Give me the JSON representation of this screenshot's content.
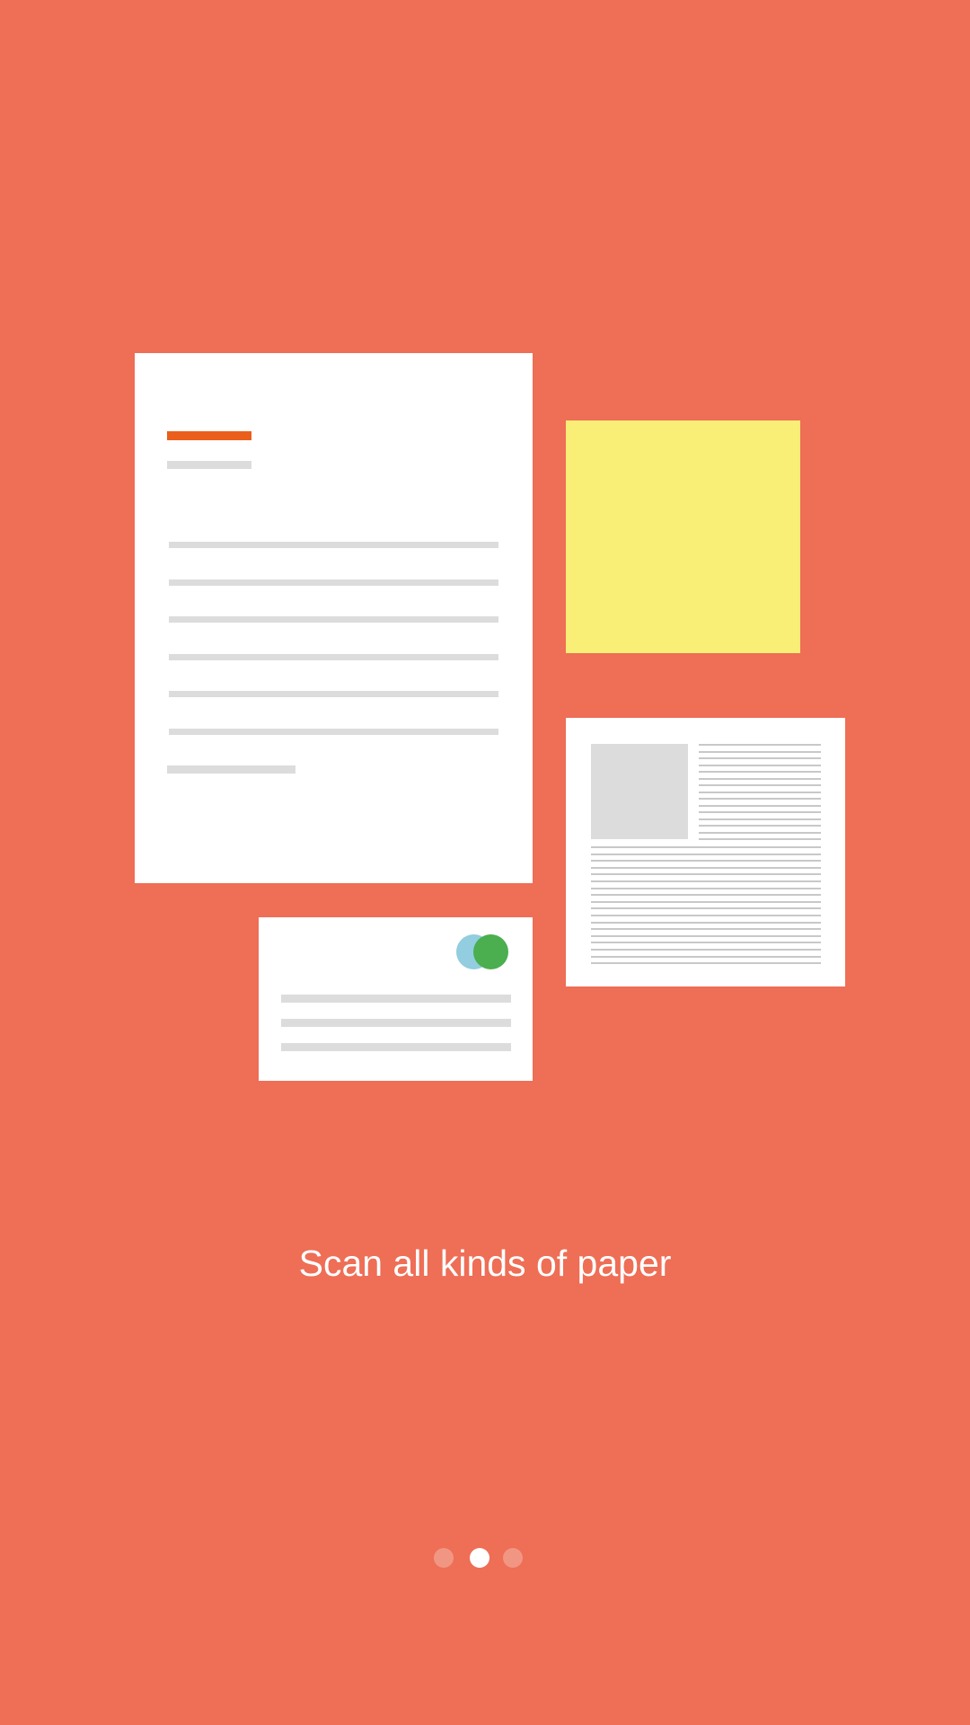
{
  "onboarding": {
    "caption": "Scan all kinds of paper",
    "page_count": 3,
    "active_page": 2
  },
  "illustration": {
    "items": [
      "letter-document",
      "sticky-note",
      "article-page",
      "business-card"
    ]
  },
  "colors": {
    "background": "#EE6E56",
    "paper": "#FFFFFF",
    "text_placeholder": "#DCDCDC",
    "letter_heading_accent": "#EA5F1B",
    "sticky_note": "#F9EE76",
    "card_logo_blue": "#92CDE0",
    "card_logo_green": "#4BAE4F",
    "dot_active": "#FFFFFF",
    "dot_inactive": "#F19682"
  }
}
